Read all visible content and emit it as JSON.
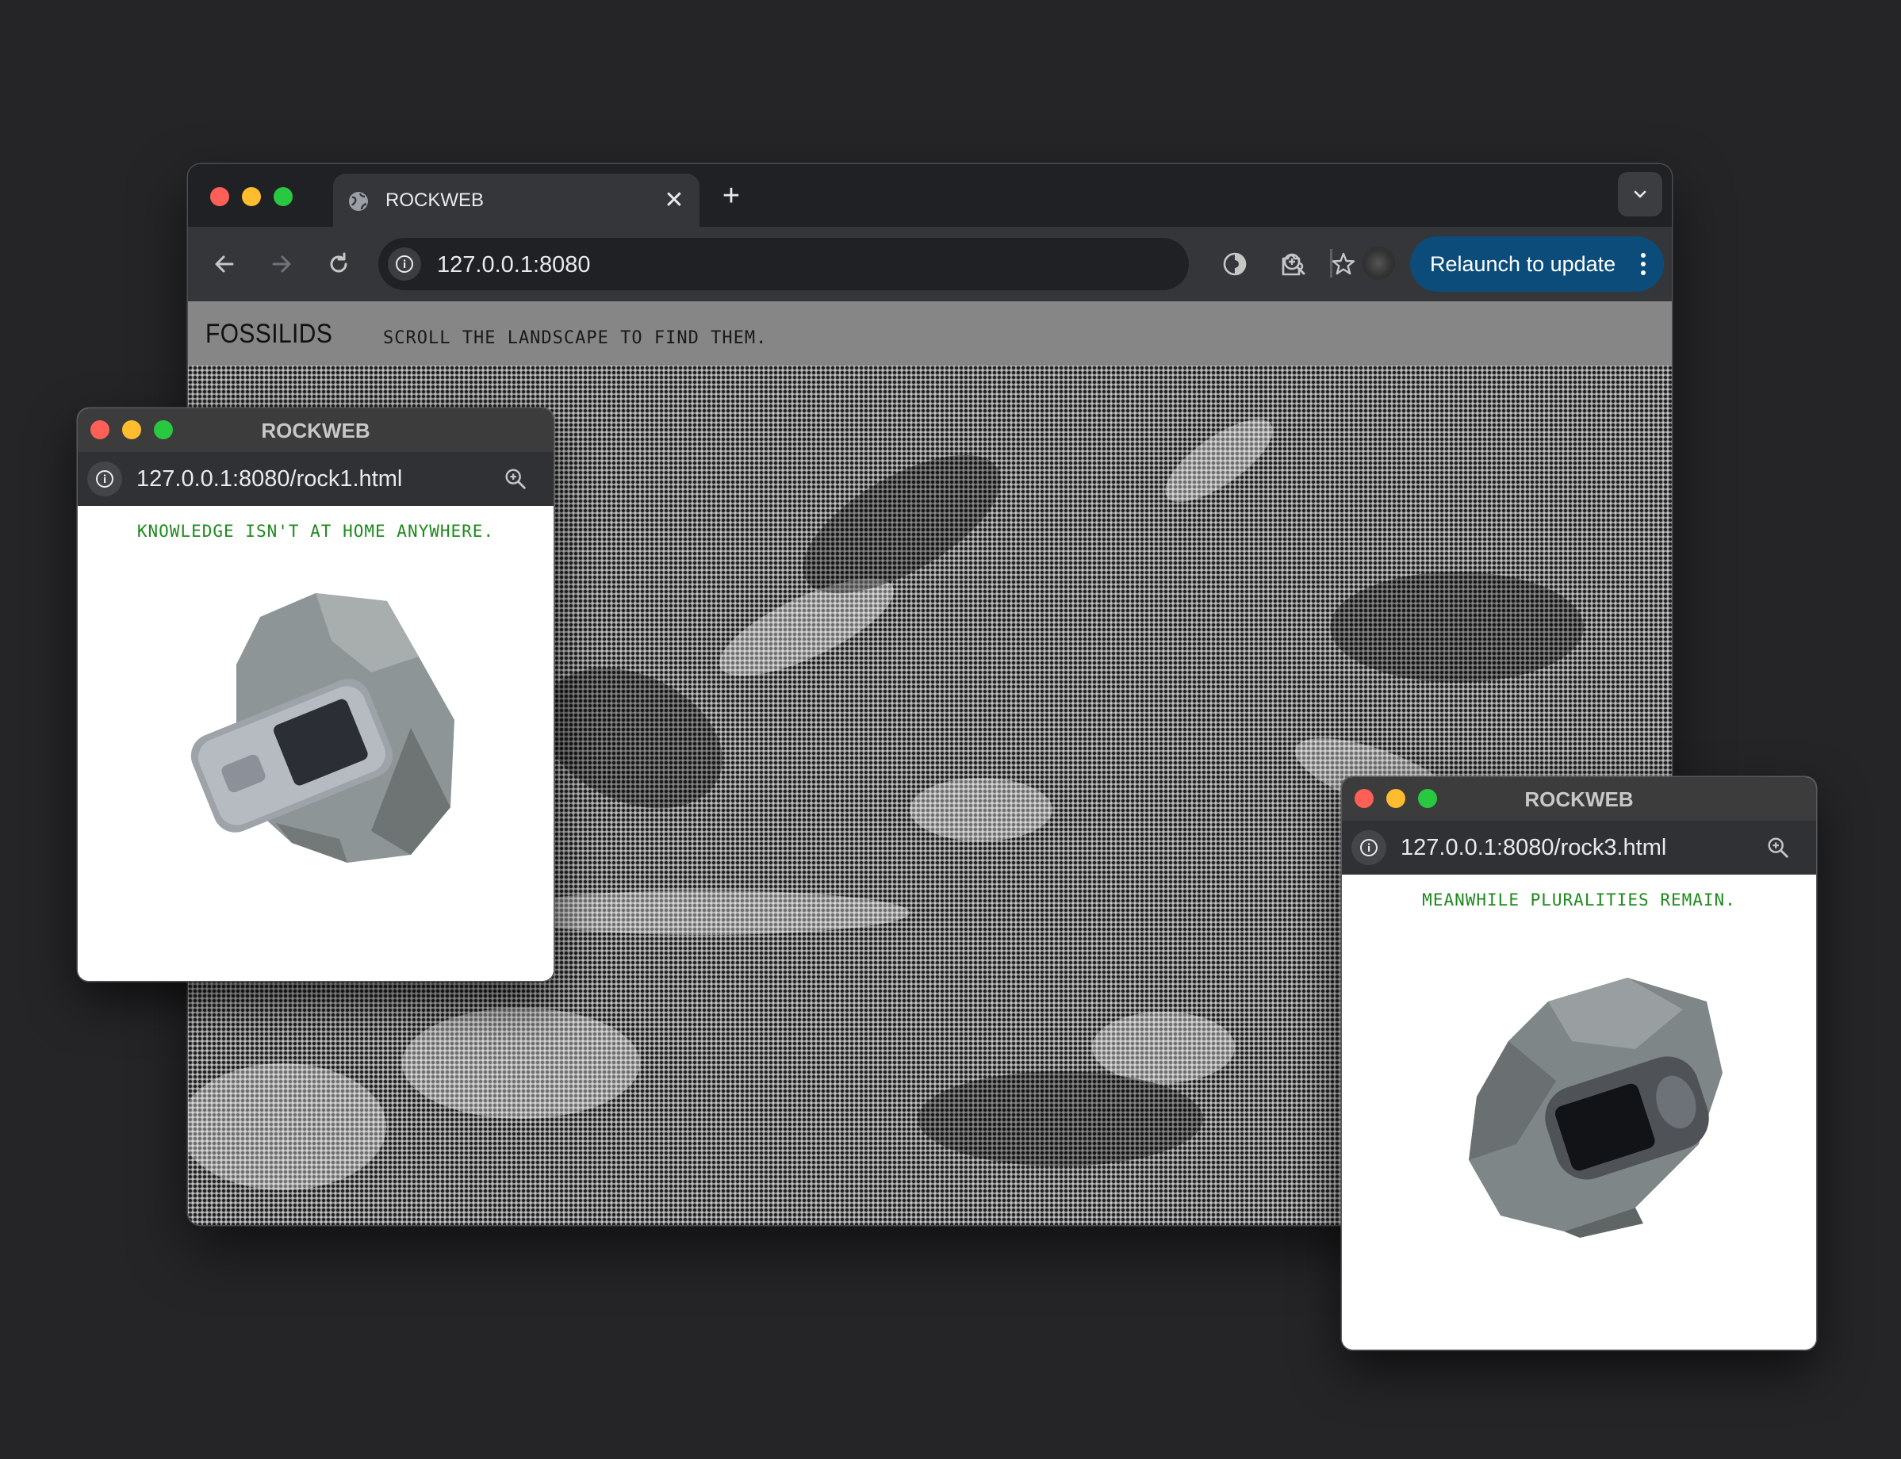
{
  "main_window": {
    "tab": {
      "title": "ROCKWEB",
      "close": "✕"
    },
    "new_tab": "+",
    "address": {
      "url": "127.0.0.1:8080"
    },
    "relaunch_label": "Relaunch to update",
    "page": {
      "title": "FOSSILIDS",
      "subtitle": "SCROLL THE LANDSCAPE TO FIND THEM."
    }
  },
  "popups": [
    {
      "title": "ROCKWEB",
      "url": "127.0.0.1:8080/rock1.html",
      "quote": "KNOWLEDGE ISN'T AT HOME ANYWHERE."
    },
    {
      "title": "ROCKWEB",
      "url": "127.0.0.1:8080/rock3.html",
      "quote": "MEANWHILE PLURALITIES REMAIN."
    }
  ],
  "icons": {
    "back": "arrow-left-icon",
    "forward": "arrow-right-icon",
    "reload": "reload-icon",
    "site_info": "info-icon",
    "zoom": "zoom-in-icon",
    "bookmark": "star-icon",
    "extension_a": "contrast-icon",
    "extension_b": "puzzle-icon",
    "menu": "more-vert-icon",
    "tab_search": "chevron-down-icon"
  },
  "colors": {
    "desktop": "#252527",
    "relaunch_button": "#0b4c7a",
    "quote_text": "#1d8a1d",
    "traffic_red": "#fe5f57",
    "traffic_yellow": "#febc2e",
    "traffic_green": "#28c840"
  }
}
